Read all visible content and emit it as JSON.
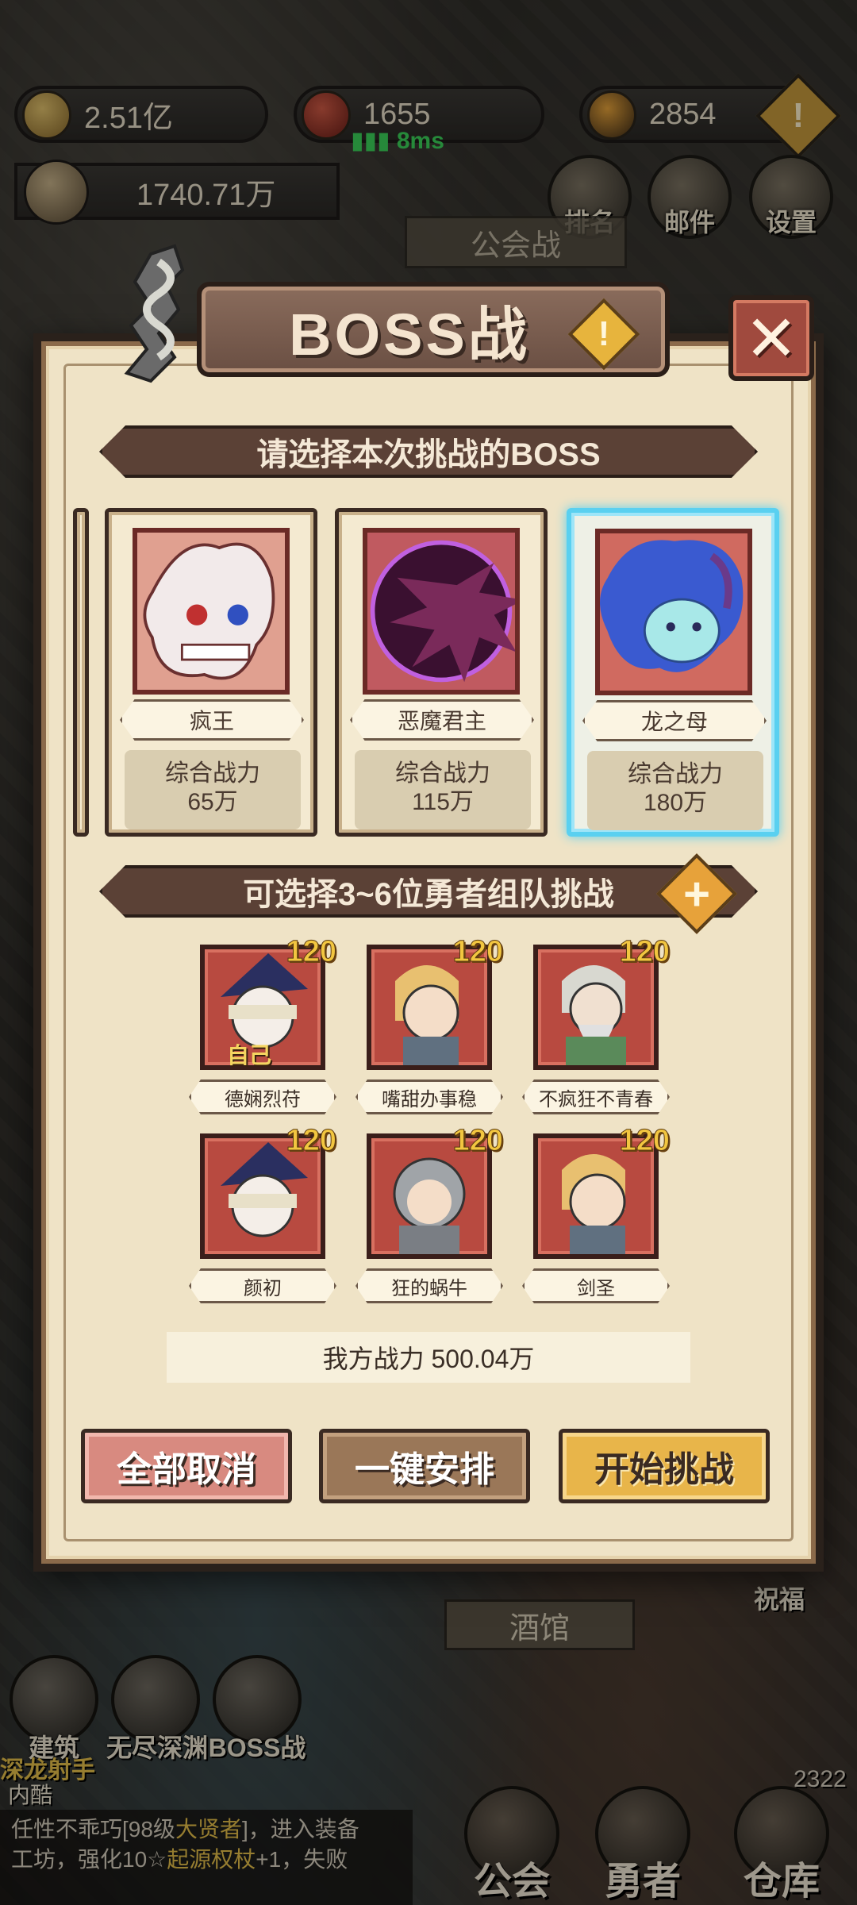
{
  "hud": {
    "gold": "2.51亿",
    "honor": "1655",
    "ping": "8ms",
    "gems": "2854",
    "total_power": "1740.71万",
    "ranking_label": "排名",
    "mail_label": "邮件",
    "settings_label": "设置",
    "guild_war_label": "公会战",
    "tavern_label": "酒馆",
    "bless_label": "祝福",
    "counter": "2322",
    "build_label": "建筑",
    "abyss_label": "无尽深渊",
    "boss_label": "BOSS战",
    "hero_title": "深龙射手",
    "hero_name": "内酷"
  },
  "log": {
    "line1_prefix": "任性不乖巧[98级",
    "line1_rank": "大贤者",
    "line1_suffix": "]，进入装备",
    "line2_prefix": "工坊，强化10☆",
    "line2_item": "起源权杖",
    "line2_suffix": "+1，失败"
  },
  "nav": {
    "guild": "公会",
    "heroes": "勇者",
    "warehouse": "仓库"
  },
  "dialog": {
    "title": "BOSS战",
    "info_icon": "!",
    "close_icon": "✕",
    "select_boss_prompt": "请选择本次挑战的BOSS",
    "team_prompt": "可选择3~6位勇者组队挑战",
    "add_icon": "+",
    "power_label": "综合战力",
    "bosses": [
      {
        "name": "疯王",
        "power": "65万",
        "color": "#e8a88f",
        "selected": false
      },
      {
        "name": "恶魔君主",
        "power": "115万",
        "color": "#8b3a6a",
        "selected": false
      },
      {
        "name": "龙之母",
        "power": "180万",
        "color": "#6fc9d9",
        "selected": true
      }
    ],
    "heroes": [
      {
        "name": "德娴烈苻",
        "level": "120",
        "self_label": "自己"
      },
      {
        "name": "嘴甜办事稳",
        "level": "120"
      },
      {
        "name": "不疯狂不青春",
        "level": "120"
      },
      {
        "name": "颜初",
        "level": "120"
      },
      {
        "name": "狂的蜗牛",
        "level": "120"
      },
      {
        "name": "剑圣",
        "level": "120"
      }
    ],
    "team_power": "我方战力 500.04万",
    "cancel_all": "全部取消",
    "auto_arrange": "一键安排",
    "start_battle": "开始挑战"
  }
}
